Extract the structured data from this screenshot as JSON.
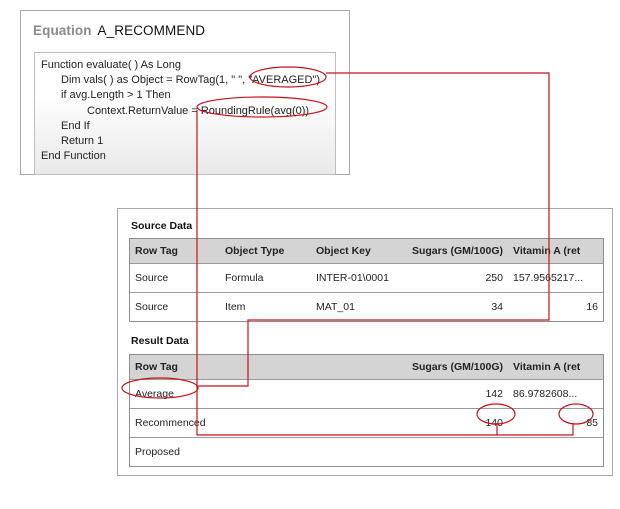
{
  "equation": {
    "title_label": "Equation",
    "title_name": "A_RECOMMEND",
    "code_lines": [
      "Function evaluate( ) As Long",
      "Dim vals( ) as Object = RowTag(1, \" \", \"AVERAGED\")",
      "if avg.Length > 1 Then",
      "Context.ReturnValue = RoundingRule(avg(0))",
      "End If",
      "Return 1",
      "End Function"
    ]
  },
  "source_data": {
    "title": "Source Data",
    "headers": [
      "Row Tag",
      "Object Type",
      "Object Key",
      "Sugars (GM/100G)",
      "Vitamin A (ret"
    ],
    "rows": [
      [
        "Source",
        "Formula",
        "INTER-01\\0001",
        "250",
        "157.9565217..."
      ],
      [
        "Source",
        "Item",
        "MAT_01",
        "34",
        "16"
      ]
    ]
  },
  "result_data": {
    "title": "Result Data",
    "headers": [
      "Row Tag",
      "Sugars (GM/100G)",
      "Vitamin A (ret"
    ],
    "rows": [
      [
        "Average",
        "142",
        "86.9782608..."
      ],
      [
        "Recommenced",
        "140",
        "85"
      ],
      [
        "Proposed",
        "",
        ""
      ]
    ]
  },
  "colors": {
    "annotation": "#c0141c",
    "header_bg": "#d4d4d4"
  }
}
